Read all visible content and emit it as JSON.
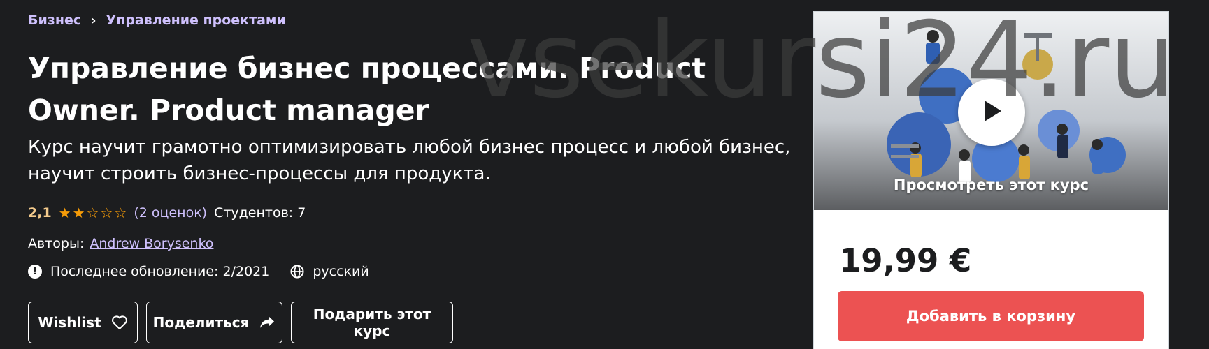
{
  "breadcrumb": {
    "items": [
      "Бизнес",
      "Управление проектами"
    ],
    "separator_icon": "chevron-right-icon"
  },
  "course": {
    "title_line1": "Управление бизнес процессами. Product",
    "title_line2": "Owner. Product manager",
    "subtitle_line1": "Курс научит грамотно оптимизировать любой бизнес процесс и любой бизнес,",
    "subtitle_line2": "научит строить бизнес-процессы для продукта.",
    "rating": "2,1",
    "rating_value": 2.1,
    "rating_max": 5,
    "reviews": "(2 оценок)",
    "students": "Студентов: 7",
    "authors_label": "Авторы:",
    "author": "Andrew Borysenko",
    "last_updated": "Последнее обновление: 2/2021",
    "language": "русский"
  },
  "actions": {
    "wishlist": "Wishlist",
    "share": "Поделиться",
    "gift": "Подарить этот курс"
  },
  "card": {
    "preview_label": "Просмотреть этот курс",
    "price": "19,99 €",
    "add_to_cart": "Добавить в корзину"
  },
  "watermark": "vsekursi24.ru",
  "colors": {
    "background": "#1c1d1f",
    "link": "#cec0fc",
    "rating": "#f3ca8c",
    "star": "#f69c08",
    "cart_button": "#ec5252"
  }
}
